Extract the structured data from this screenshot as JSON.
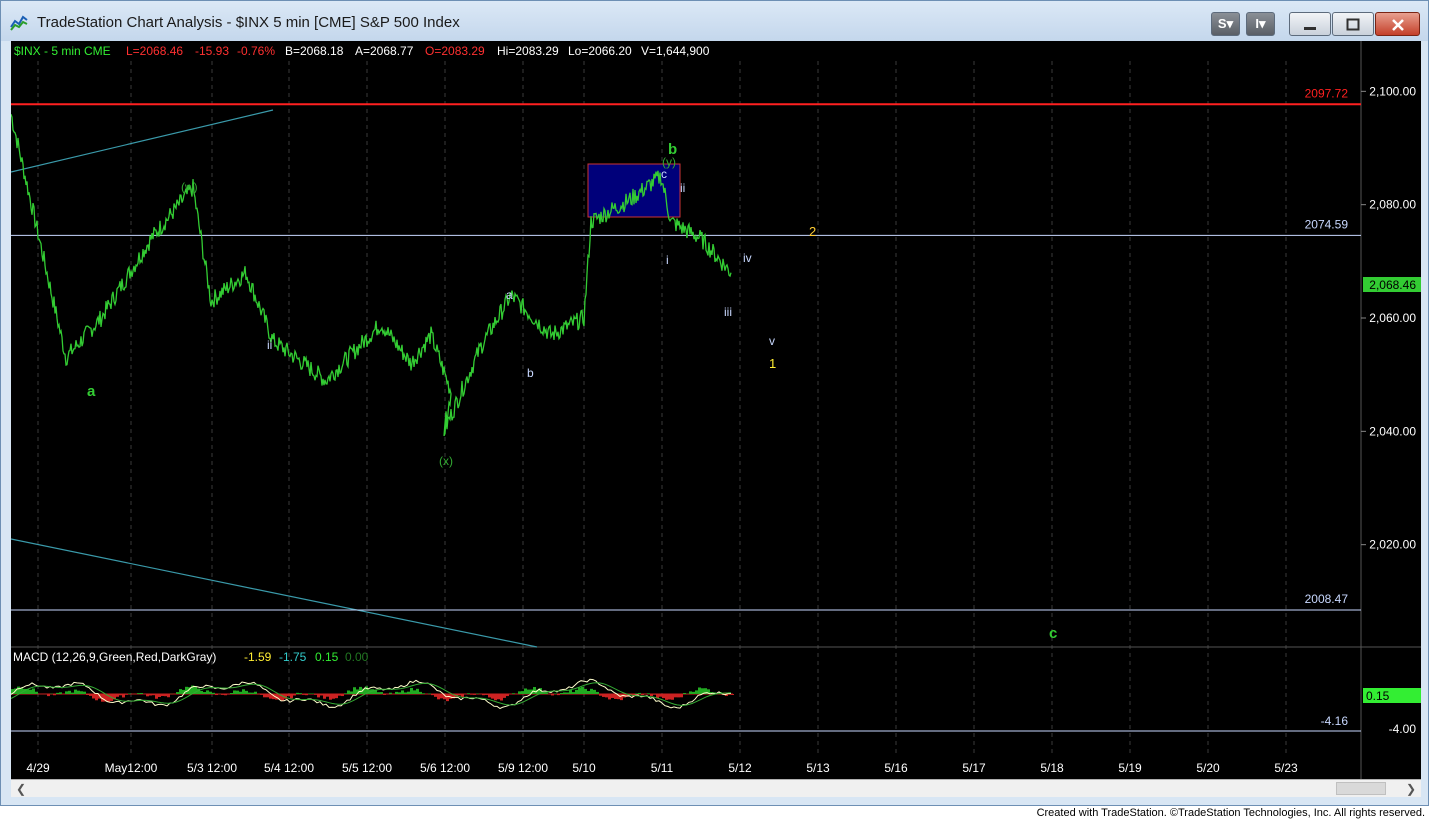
{
  "window": {
    "title": "TradeStation Chart Analysis - $INX 5 min [CME] S&P 500 Index",
    "buttons": {
      "s": "S",
      "i": "I"
    }
  },
  "header": {
    "symbol": "$INX - 5 min  CME",
    "last": "L=2068.46",
    "change": "-15.93",
    "change_pct": "-0.76%",
    "bid": "B=2068.18",
    "ask": "A=2068.77",
    "open": "O=2083.29",
    "high": "Hi=2083.29",
    "low": "Lo=2066.20",
    "volume": "V=1,644,900"
  },
  "price_axis": {
    "ticks": [
      "2,100.00",
      "2,080.00",
      "2,060.00",
      "2,040.00",
      "2,020.00"
    ],
    "last_price_label": "2,068.46",
    "range": [
      2003,
      2108
    ]
  },
  "levels": [
    {
      "label": "2097.72",
      "value": 2097.72,
      "color": "#ff2020"
    },
    {
      "label": "2074.59",
      "value": 2074.59,
      "color": "#c8d8ff"
    },
    {
      "label": "2008.47",
      "value": 2008.47,
      "color": "#c8d8ff"
    }
  ],
  "wave_labels": {
    "a_major": "a",
    "w": "(w)",
    "x": "(x)",
    "y": "(y)",
    "b_major": "b",
    "c_small": "c",
    "ii_left": "ii",
    "a_small": "a",
    "b_small": "b",
    "i": "i",
    "ii": "ii",
    "iii": "iii",
    "iv": "iv",
    "v": "v",
    "one": "1",
    "two": "2",
    "c_major": "c"
  },
  "macd": {
    "title": "MACD (12,26,9,Green,Red,DarkGray)",
    "v1": "-1.59",
    "v2": "-1.75",
    "v3": "0.15",
    "v4": "0.00",
    "axis_label": "-4.00",
    "current_label": "0.15",
    "level_label": "-4.16"
  },
  "time_axis": {
    "labels": [
      "4/29",
      "May12:00",
      "5/3 12:00",
      "5/4 12:00",
      "5/5 12:00",
      "5/6 12:00",
      "5/9 12:00",
      "5/10",
      "5/11",
      "5/12",
      "5/13",
      "5/16",
      "5/17",
      "5/18",
      "5/19",
      "5/20",
      "5/23"
    ]
  },
  "footer": "Created with TradeStation. ©TradeStation Technologies, Inc. All rights reserved.",
  "colors": {
    "price": "#33cc33",
    "level_red": "#ff2020",
    "box": "#00007a",
    "trendline": "#4aa8b8"
  },
  "chart_data": {
    "type": "line",
    "title": "$INX - 5 min CME",
    "series": [
      {
        "name": "$INX",
        "x": [
          "4/29",
          "4/29",
          "4/29",
          "May",
          "May",
          "5/3",
          "5/3",
          "5/3",
          "5/4",
          "5/4",
          "5/5",
          "5/5",
          "5/5",
          "5/6",
          "5/6",
          "5/9",
          "5/9",
          "5/9",
          "5/10",
          "5/10",
          "5/10",
          "5/11",
          "5/11",
          "5/11",
          "5/11"
        ],
        "values": [
          2096,
          2082,
          2053,
          2060,
          2074,
          2083,
          2063,
          2068,
          2056,
          2049,
          2059,
          2052,
          2057,
          2047,
          2040,
          2055,
          2064,
          2057,
          2060,
          2077,
          2081,
          2085,
          2077,
          2074,
          2068
        ]
      }
    ],
    "ylim": [
      2003,
      2108
    ]
  }
}
